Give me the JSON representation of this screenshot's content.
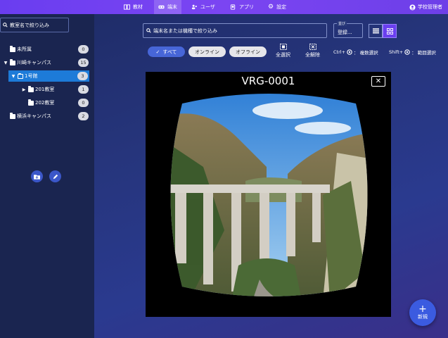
{
  "nav": {
    "items": [
      {
        "label": "教材",
        "icon": "book-icon"
      },
      {
        "label": "端末",
        "icon": "vr-headset-icon"
      },
      {
        "label": "ユーザ",
        "icon": "users-icon"
      },
      {
        "label": "アプリ",
        "icon": "app-icon"
      },
      {
        "label": "設定",
        "icon": "gear-icon"
      }
    ],
    "user": "学校管理者"
  },
  "sidebar": {
    "search_placeholder": "教室名で絞り込み",
    "tree": [
      {
        "label": "未所属",
        "count": "0"
      },
      {
        "label": "川崎キャンパス",
        "count": "15"
      },
      {
        "label": "1号館",
        "count": "3"
      },
      {
        "label": "201教室",
        "count": "1"
      },
      {
        "label": "202教室",
        "count": "0"
      },
      {
        "label": "横浜キャンパス",
        "count": "2"
      }
    ]
  },
  "toolbar": {
    "search_placeholder": "端末名または機種で絞り込み",
    "sort_caption": "並び",
    "sort_value": "登録...",
    "filters": {
      "all": "すべて",
      "online": "オンライン",
      "offline": "オフライン"
    },
    "select_all": "全選択",
    "deselect_all": "全解除",
    "hint_ctrl_key": "Ctrl+",
    "hint_ctrl_text": "： 複数選択",
    "hint_shift_key": "Shift+",
    "hint_shift_text": "： 範囲選択"
  },
  "preview": {
    "title": "VRG-0001"
  },
  "fab": {
    "label": "新規",
    "color": "#3b5be0"
  }
}
